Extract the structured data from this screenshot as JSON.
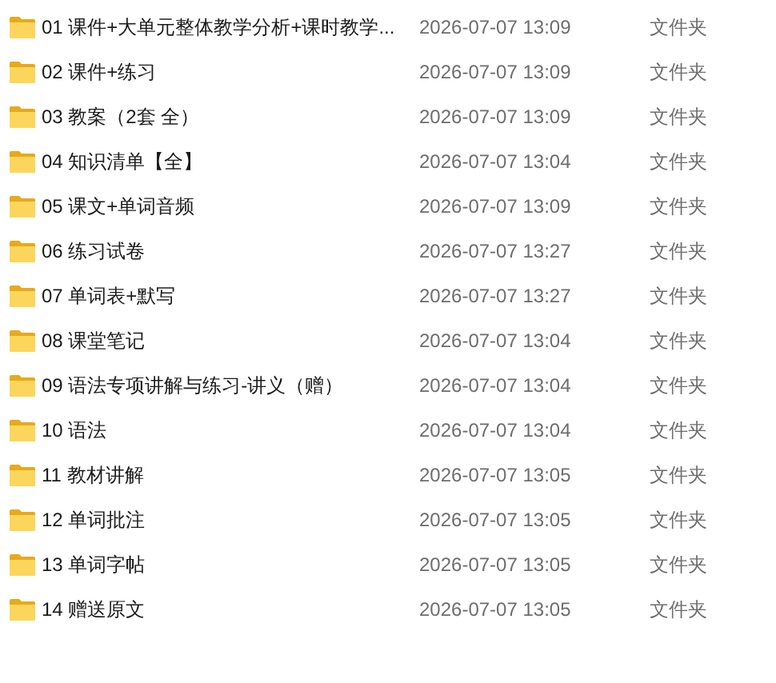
{
  "files": [
    {
      "name": "01 课件+大单元整体教学分析+课时教学...",
      "modified": "2026-07-07 13:09",
      "type": "文件夹"
    },
    {
      "name": "02 课件+练习",
      "modified": "2026-07-07 13:09",
      "type": "文件夹"
    },
    {
      "name": "03 教案（2套 全）",
      "modified": "2026-07-07 13:09",
      "type": "文件夹"
    },
    {
      "name": "04 知识清单【全】",
      "modified": "2026-07-07 13:04",
      "type": "文件夹"
    },
    {
      "name": "05 课文+单词音频",
      "modified": "2026-07-07 13:09",
      "type": "文件夹"
    },
    {
      "name": "06 练习试卷",
      "modified": "2026-07-07 13:27",
      "type": "文件夹"
    },
    {
      "name": "07 单词表+默写",
      "modified": "2026-07-07 13:27",
      "type": "文件夹"
    },
    {
      "name": "08 课堂笔记",
      "modified": "2026-07-07 13:04",
      "type": "文件夹"
    },
    {
      "name": "09 语法专项讲解与练习-讲义（赠）",
      "modified": "2026-07-07 13:04",
      "type": "文件夹"
    },
    {
      "name": "10 语法",
      "modified": "2026-07-07 13:04",
      "type": "文件夹"
    },
    {
      "name": "11 教材讲解",
      "modified": "2026-07-07 13:05",
      "type": "文件夹"
    },
    {
      "name": "12 单词批注",
      "modified": "2026-07-07 13:05",
      "type": "文件夹"
    },
    {
      "name": "13 单词字帖",
      "modified": "2026-07-07 13:05",
      "type": "文件夹"
    },
    {
      "name": "14 赠送原文",
      "modified": "2026-07-07 13:05",
      "type": "文件夹"
    }
  ]
}
